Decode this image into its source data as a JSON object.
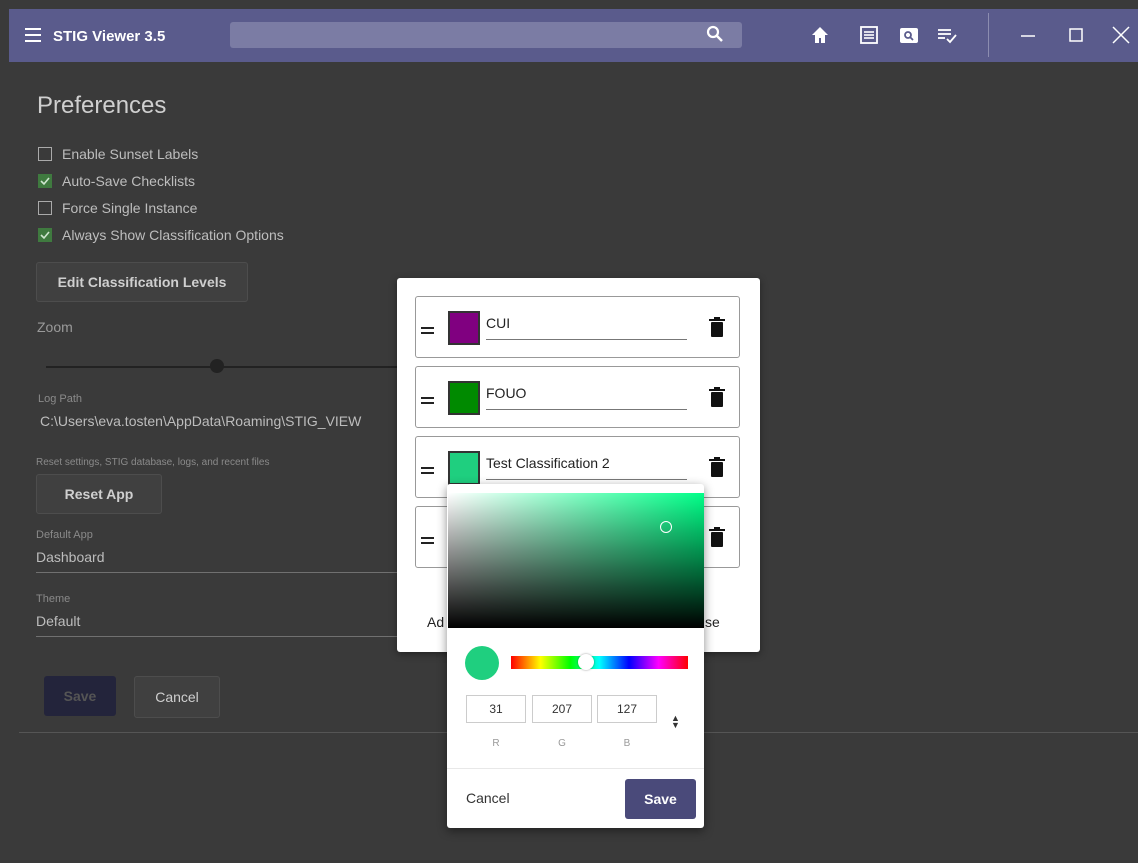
{
  "window": {
    "title": "STIG Viewer 3.5",
    "controls": [
      "minimize-icon",
      "maximize-icon",
      "close-icon"
    ]
  },
  "toolbar": {
    "search": {
      "value": "",
      "placeholder": ""
    },
    "icons": [
      "home-icon",
      "list-icon",
      "search-checklist-icon",
      "checklist-icon"
    ]
  },
  "preferences": {
    "title": "Preferences",
    "options": [
      {
        "label": "Enable Sunset Labels",
        "checked": false
      },
      {
        "label": "Auto-Save Checklists",
        "checked": true
      },
      {
        "label": "Force Single Instance",
        "checked": false
      },
      {
        "label": "Always Show Classification Options",
        "checked": true
      }
    ],
    "edit_levels_label": "Edit Classification Levels",
    "zoom_label": "Zoom",
    "log_path_label": "Log Path",
    "log_path_value": "C:\\Users\\eva.tosten\\AppData\\Roaming\\STIG_VIEW",
    "reset_hint": "Reset settings, STIG database, logs, and recent files",
    "reset_label": "Reset App",
    "default_app_label": "Default App",
    "default_app_value": "Dashboard",
    "theme_label": "Theme",
    "theme_value": "Default",
    "save_label": "Save",
    "cancel_label": "Cancel"
  },
  "classification_dialog": {
    "levels": [
      {
        "name": "CUI",
        "color": "#800080"
      },
      {
        "name": "FOUO",
        "color": "#008a00"
      },
      {
        "name": "Test Classification 2",
        "color": "#1fcf7f"
      },
      {
        "name": "",
        "color": "#1fcf7f"
      }
    ],
    "add_label": "Ad",
    "close_label": "se"
  },
  "color_picker": {
    "current_color": "#1fcf7f",
    "rgb": {
      "r": "31",
      "g": "207",
      "b": "127"
    },
    "labels": {
      "r": "R",
      "g": "G",
      "b": "B"
    },
    "cancel_label": "Cancel",
    "save_label": "Save"
  }
}
